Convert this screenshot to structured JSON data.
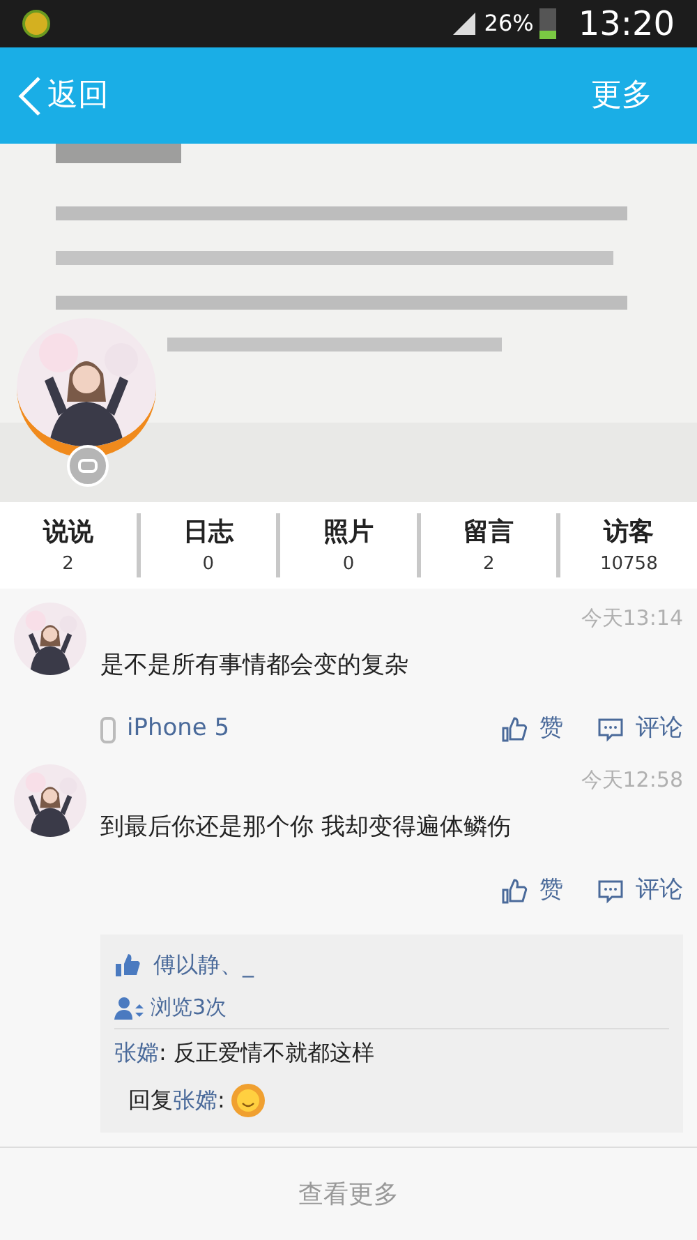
{
  "status_bar": {
    "battery": "26%",
    "time": "13:20"
  },
  "nav": {
    "back": "返回",
    "more": "更多"
  },
  "stats": [
    {
      "label": "说说",
      "count": "2"
    },
    {
      "label": "日志",
      "count": "0"
    },
    {
      "label": "照片",
      "count": "0"
    },
    {
      "label": "留言",
      "count": "2"
    },
    {
      "label": "访客",
      "count": "10758"
    }
  ],
  "posts": [
    {
      "time": "今天13:14",
      "text": "是不是所有事情都会变的复杂",
      "device": "iPhone 5",
      "like": "赞",
      "comment": "评论"
    },
    {
      "time": "今天12:58",
      "text": "到最后你还是那个你 我却变得遍体鳞伤",
      "like": "赞",
      "comment": "评论",
      "likes": "傅以静、_",
      "views": "浏览3次",
      "comments": [
        {
          "kind": "comment",
          "author": "张嫦",
          "text": ": 反正爱情不就都这样"
        },
        {
          "kind": "reply",
          "prefix": "回复",
          "author": "张嫦",
          "text": ":"
        }
      ]
    }
  ],
  "footer": "查看更多"
}
